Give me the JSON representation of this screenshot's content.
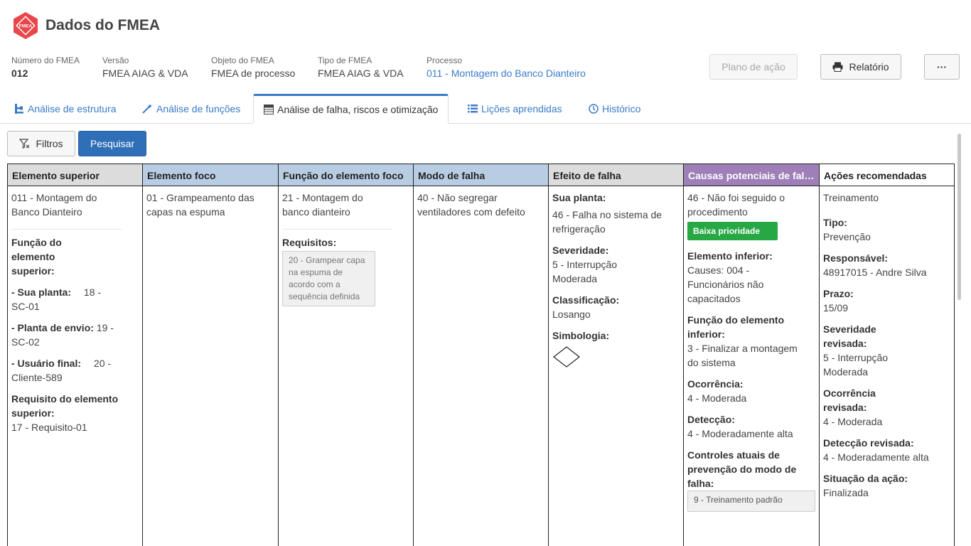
{
  "header": {
    "logo_text": "FMEA",
    "title": "Dados do FMEA",
    "brand_color": "#e8464a"
  },
  "meta": {
    "numero_label": "Número do FMEA",
    "numero_value": "012",
    "versao_label": "Versão",
    "versao_value": "FMEA AIAG & VDA",
    "objeto_label": "Objeto do FMEA",
    "objeto_value": "FMEA de processo",
    "tipo_label": "Tipo de FMEA",
    "tipo_value": "FMEA AIAG & VDA",
    "processo_label": "Processo",
    "processo_value": "011 - Montagem do Banco Dianteiro"
  },
  "actions": {
    "plano_label": "Plano de ação",
    "relatorio_label": "Relatório",
    "more_label": "···"
  },
  "tabs": [
    {
      "label": "Análise de estrutura",
      "icon": "structure-icon"
    },
    {
      "label": "Análise de funções",
      "icon": "magic-wand-icon"
    },
    {
      "label": "Análise de falha, riscos e otimização",
      "icon": "table-icon"
    },
    {
      "label": "Lições aprendidas",
      "icon": "list-icon"
    },
    {
      "label": "Histórico",
      "icon": "clock-icon"
    }
  ],
  "toolbar": {
    "filtros_label": "Filtros",
    "pesquisar_label": "Pesquisar"
  },
  "columns": {
    "c1": "Elemento superior",
    "c2": "Elemento foco",
    "c3": "Função do elemento foco",
    "c4": "Modo de falha",
    "c5": "Efeito de falha",
    "c6": "Causas potenciais de falha",
    "c7": "Ações recomendadas"
  },
  "row": {
    "c1": {
      "elemento": "011 - Montagem do Banco Dianteiro",
      "funcao_label": "Função do elemento superior:",
      "sua_planta_label": "- Sua planta:",
      "sua_planta_value": "18 - SC-01",
      "planta_envio_label": "- Planta de envio:",
      "planta_envio_value": "19 - SC-02",
      "usuario_final_label": "- Usuário final:",
      "usuario_final_value": "20 - Cliente-589",
      "requisito_label": "Requisito do elemento superior:",
      "requisito_value": "17 - Requisito-01"
    },
    "c2": {
      "elemento": "01 - Grampeamento das capas na espuma"
    },
    "c3": {
      "funcao": "21 - Montagem do banco dianteiro",
      "requisitos_label": "Requisitos:",
      "requisito_item": "20 - Grampear capa na espuma de acordo com a sequência definida"
    },
    "c4": {
      "modo": "40 - Não segregar ventiladores com defeito"
    },
    "c5": {
      "sua_planta_label": "Sua planta:",
      "sua_planta_value": "46 - Falha no sistema de refrigeração",
      "severidade_label": "Severidade:",
      "severidade_value": "5 - Interrupção Moderada",
      "classificacao_label": "Classificação:",
      "classificacao_value": "Losango",
      "simbologia_label": "Simbologia:",
      "simbologia_icon": "diamond-icon"
    },
    "c6": {
      "causa": "46 - Não foi seguido o procedimento",
      "prioridade_badge": "Baixa prioridade",
      "badge_color": "#27a844",
      "elemento_inferior_label": "Elemento inferior:",
      "elemento_inferior_value": "Causes: 004 - Funcionários não capacitados",
      "funcao_inferior_label": "Função do elemento inferior:",
      "funcao_inferior_value": "3 - Finalizar a montagem do sistema",
      "ocorrencia_label": "Ocorrência:",
      "ocorrencia_value": "4 - Moderada",
      "deteccao_label": "Detecção:",
      "deteccao_value": "4 - Moderadamente alta",
      "controles_label": "Controles atuais de prevenção do modo de falha:",
      "controles_item": "9 - Treinamento padrão"
    },
    "c7": {
      "acao": "Treinamento",
      "tipo_label": "Tipo:",
      "tipo_value": "Prevenção",
      "responsavel_label": "Responsável:",
      "responsavel_value": "48917015 - Andre Silva",
      "prazo_label": "Prazo:",
      "prazo_value": "15/09",
      "sev_rev_label": "Severidade revisada:",
      "sev_rev_value": "5 - Interrupção Moderada",
      "oc_rev_label": "Ocorrência revisada:",
      "oc_rev_value": "4 - Moderada",
      "det_rev_label": "Detecção revisada:",
      "det_rev_value": "4 - Moderadamente alta",
      "situacao_label": "Situação da ação:",
      "situacao_value": "Finalizada"
    }
  }
}
